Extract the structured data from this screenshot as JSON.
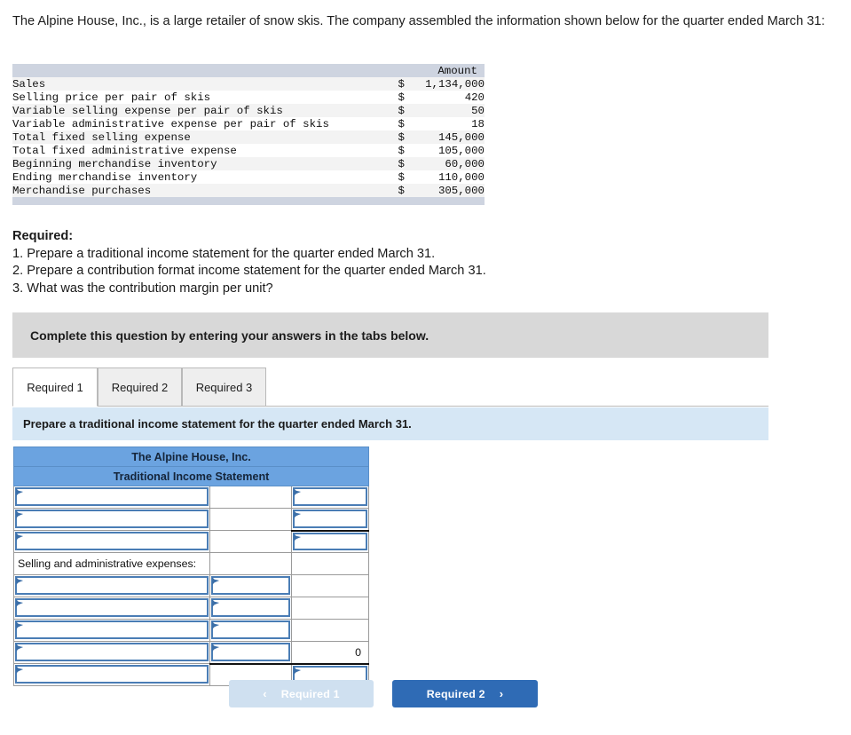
{
  "intro": {
    "text": "The Alpine House, Inc., is a large retailer of snow skis. The company assembled the information shown below for the quarter ended March 31:"
  },
  "fact_table": {
    "amount_header": "Amount",
    "rows": [
      {
        "label": "Sales",
        "currency": "$",
        "amount": "1,134,000"
      },
      {
        "label": "Selling price per pair of skis",
        "currency": "$",
        "amount": "420"
      },
      {
        "label": "Variable selling expense per pair of skis",
        "currency": "$",
        "amount": "50"
      },
      {
        "label": "Variable administrative expense per pair of skis",
        "currency": "$",
        "amount": "18"
      },
      {
        "label": "Total fixed selling expense",
        "currency": "$",
        "amount": "145,000"
      },
      {
        "label": "Total fixed administrative expense",
        "currency": "$",
        "amount": "105,000"
      },
      {
        "label": "Beginning merchandise inventory",
        "currency": "$",
        "amount": "60,000"
      },
      {
        "label": "Ending merchandise inventory",
        "currency": "$",
        "amount": "110,000"
      },
      {
        "label": "Merchandise purchases",
        "currency": "$",
        "amount": "305,000"
      }
    ]
  },
  "required": {
    "title": "Required:",
    "items": [
      "1. Prepare a traditional income statement for the quarter ended March 31.",
      "2. Prepare a contribution format income statement for the quarter ended March 31.",
      "3. What was the contribution margin per unit?"
    ]
  },
  "gray_banner": {
    "text": "Complete this question by entering your answers in the tabs below."
  },
  "tabs": [
    {
      "label": "Required 1",
      "active": true
    },
    {
      "label": "Required 2",
      "active": false
    },
    {
      "label": "Required 3",
      "active": false
    }
  ],
  "blue_strip": {
    "text": "Prepare a traditional income statement for the quarter ended March 31."
  },
  "worksheet": {
    "company_name": "The Alpine House, Inc.",
    "statement_title": "Traditional Income Statement",
    "rows": [
      {
        "kind": "input",
        "label": "",
        "col2": "",
        "col3": ""
      },
      {
        "kind": "input",
        "label": "",
        "col2": "",
        "col3": ""
      },
      {
        "kind": "input",
        "label": "",
        "col2": "",
        "col3": ""
      },
      {
        "kind": "static",
        "label": "Selling and administrative expenses:",
        "col2": "",
        "col3": ""
      },
      {
        "kind": "input2",
        "label": "",
        "col2": "",
        "col3": ""
      },
      {
        "kind": "input2",
        "label": "",
        "col2": "",
        "col3": ""
      },
      {
        "kind": "input2",
        "label": "",
        "col2": "",
        "col3": ""
      },
      {
        "kind": "input2",
        "label": "",
        "col2": "",
        "col3": "0"
      },
      {
        "kind": "final",
        "label": "",
        "col2": "",
        "col3": ""
      }
    ],
    "computed_total": "0"
  },
  "nav": {
    "prev_label": "Required 1",
    "prev_chevron": "‹",
    "next_label": "Required 2",
    "next_chevron": "›"
  },
  "colors": {
    "header_blue": "#6ba3e0",
    "strip_blue": "#d6e7f5",
    "banner_gray": "#d8d8d8",
    "table_head_gray": "#ced4e0",
    "input_border": "#4a7db5",
    "next_button": "#2f6bb5",
    "prev_button": "#cfe0f0"
  }
}
